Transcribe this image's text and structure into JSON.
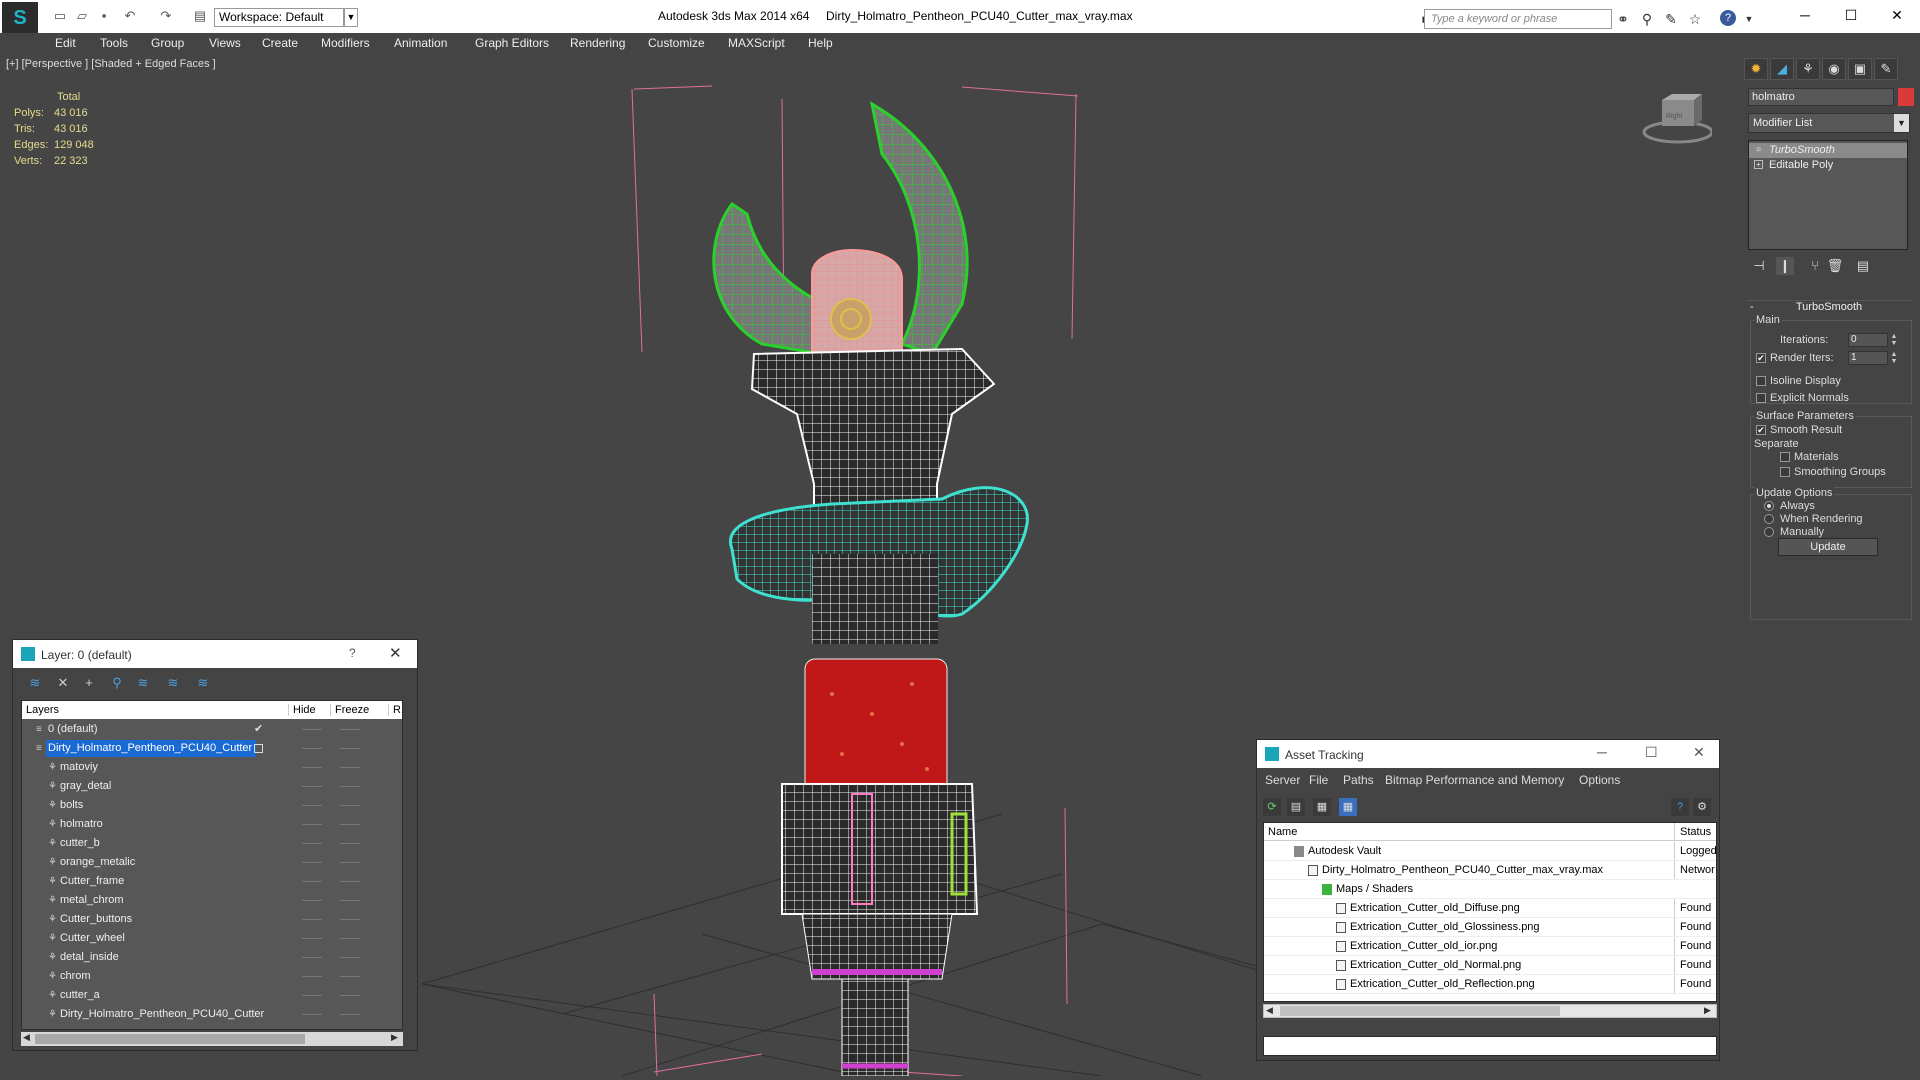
{
  "window": {
    "app_title": "Autodesk 3ds Max  2014 x64",
    "doc_title": "Dirty_Holmatro_Pentheon_PCU40_Cutter_max_vray.max",
    "workspace": "Workspace: Default",
    "search_placeholder": "Type a keyword or phrase"
  },
  "menu": [
    "Edit",
    "Tools",
    "Group",
    "Views",
    "Create",
    "Modifiers",
    "Animation",
    "Graph Editors",
    "Rendering",
    "Customize",
    "MAXScript",
    "Help"
  ],
  "viewport": {
    "label": "[+] [Perspective ] [Shaded + Edged Faces ]",
    "stats": {
      "header": "Total",
      "rows": [
        {
          "label": "Polys:",
          "value": "43 016"
        },
        {
          "label": "Tris:",
          "value": "43 016"
        },
        {
          "label": "Edges:",
          "value": "129 048"
        },
        {
          "label": "Verts:",
          "value": "22 323"
        }
      ]
    },
    "viewcube_label": "Right"
  },
  "command_panel": {
    "object_name": "holmatro",
    "object_color": "#d93a3a",
    "modifier_list": "Modifier List",
    "stack": [
      "TurboSmooth",
      "Editable Poly"
    ],
    "rollout": "TurboSmooth",
    "main_label": "Main",
    "iterations_label": "Iterations:",
    "iterations_value": "0",
    "render_iters_label": "Render Iters:",
    "render_iters_value": "1",
    "isoline": "Isoline Display",
    "explicit_normals": "Explicit Normals",
    "surface_params": "Surface Parameters",
    "smooth_result": "Smooth Result",
    "separate": "Separate",
    "materials": "Materials",
    "smoothing_groups": "Smoothing Groups",
    "update_options": "Update Options",
    "always": "Always",
    "when_rendering": "When Rendering",
    "manually": "Manually",
    "update_btn": "Update"
  },
  "layer_panel": {
    "title": "Layer: 0 (default)",
    "help": "?",
    "columns": {
      "layers": "Layers",
      "hide": "Hide",
      "freeze": "Freeze",
      "render": "R"
    },
    "rows": [
      {
        "name": "0 (default)",
        "child": false,
        "selected": false,
        "check": true
      },
      {
        "name": "Dirty_Holmatro_Pentheon_PCU40_Cutter",
        "child": false,
        "selected": true,
        "check": false
      },
      {
        "name": "matoviy",
        "child": true
      },
      {
        "name": "gray_detal",
        "child": true
      },
      {
        "name": "bolts",
        "child": true
      },
      {
        "name": "holmatro",
        "child": true
      },
      {
        "name": "cutter_b",
        "child": true
      },
      {
        "name": "orange_metalic",
        "child": true
      },
      {
        "name": "Cutter_frame",
        "child": true
      },
      {
        "name": "metal_chrom",
        "child": true
      },
      {
        "name": "Cutter_buttons",
        "child": true
      },
      {
        "name": "Cutter_wheel",
        "child": true
      },
      {
        "name": "detal_inside",
        "child": true
      },
      {
        "name": "chrom",
        "child": true
      },
      {
        "name": "cutter_a",
        "child": true
      },
      {
        "name": "Dirty_Holmatro_Pentheon_PCU40_Cutter",
        "child": true
      }
    ]
  },
  "asset_panel": {
    "title": "Asset Tracking",
    "menu": [
      "Server",
      "File",
      "Paths",
      "Bitmap Performance and Memory",
      "Options"
    ],
    "columns": {
      "name": "Name",
      "status": "Status"
    },
    "rows": [
      {
        "name": "Autodesk Vault",
        "status": "Logged",
        "indent": 1
      },
      {
        "name": "Dirty_Holmatro_Pentheon_PCU40_Cutter_max_vray.max",
        "status": "Networ",
        "indent": 2
      },
      {
        "name": "Maps / Shaders",
        "status": "",
        "indent": 3
      },
      {
        "name": "Extrication_Cutter_old_Diffuse.png",
        "status": "Found",
        "indent": 4
      },
      {
        "name": "Extrication_Cutter_old_Glossiness.png",
        "status": "Found",
        "indent": 4
      },
      {
        "name": "Extrication_Cutter_old_ior.png",
        "status": "Found",
        "indent": 4
      },
      {
        "name": "Extrication_Cutter_old_Normal.png",
        "status": "Found",
        "indent": 4
      },
      {
        "name": "Extrication_Cutter_old_Reflection.png",
        "status": "Found",
        "indent": 4
      }
    ]
  }
}
